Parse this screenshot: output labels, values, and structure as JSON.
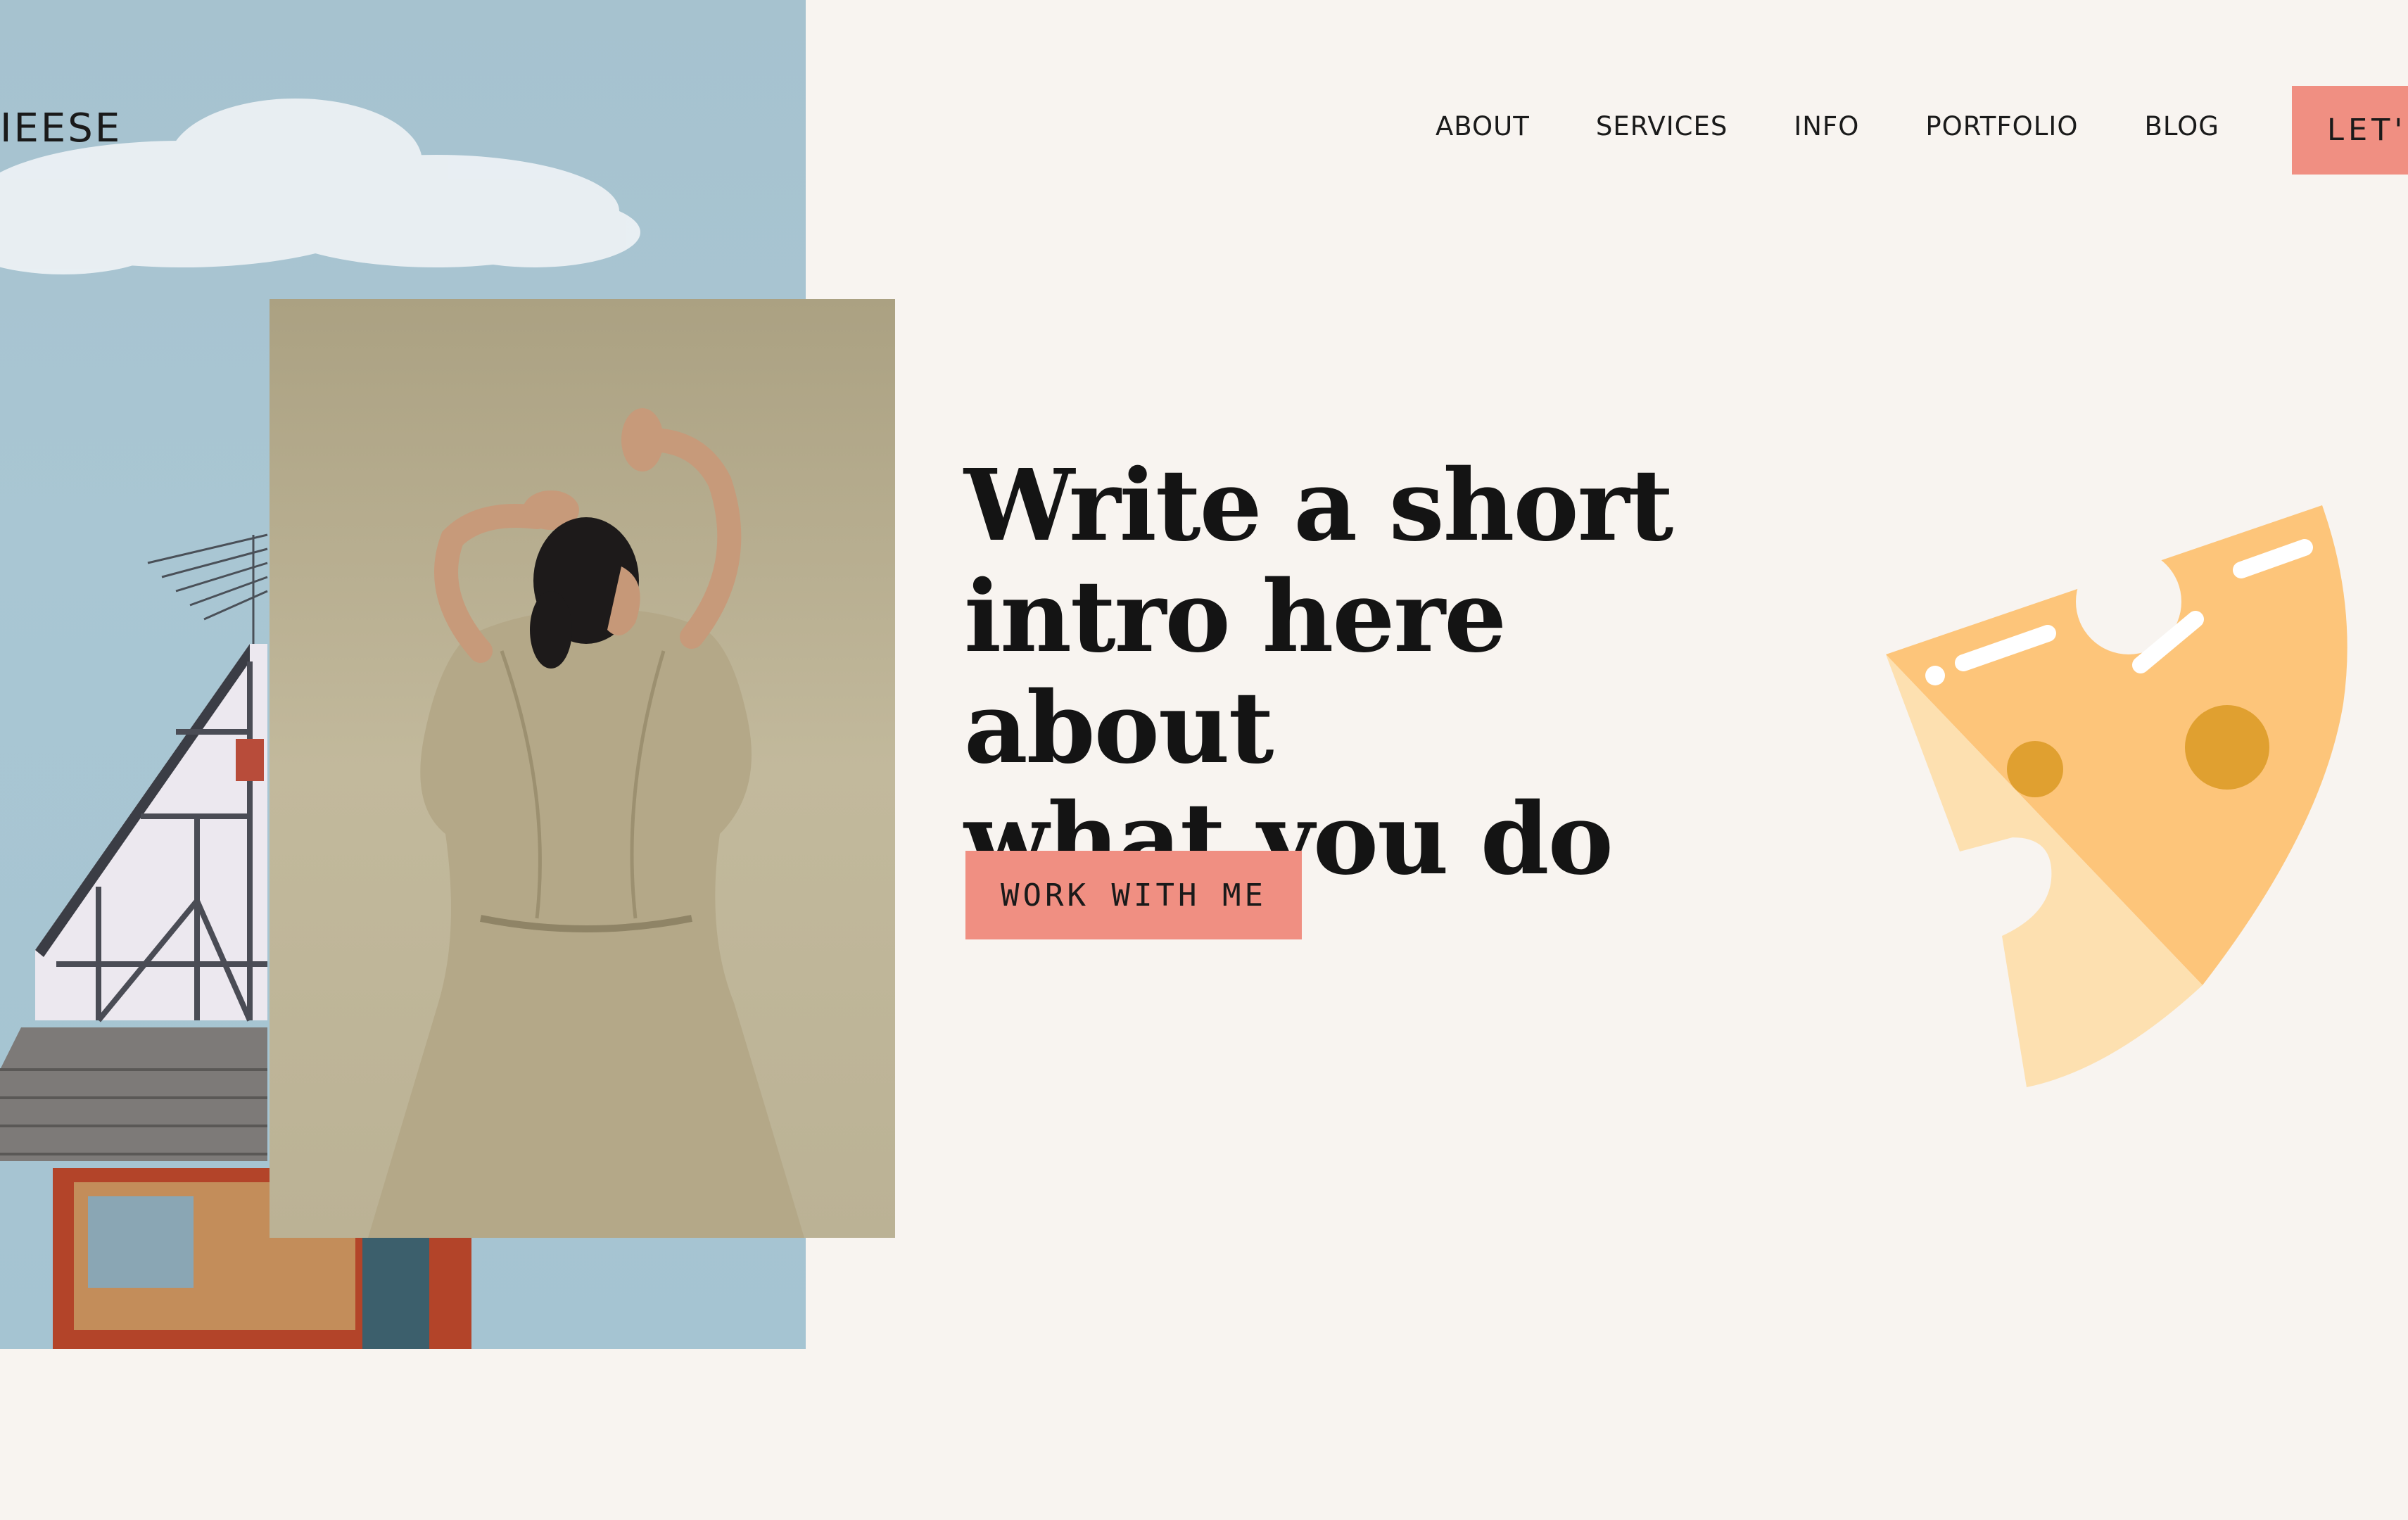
{
  "brand": {
    "name": "IEESE"
  },
  "nav": {
    "items": [
      {
        "label": "ABOUT"
      },
      {
        "label": "SERVICES"
      },
      {
        "label": "INFO"
      },
      {
        "label": "PORTFOLIO"
      },
      {
        "label": "BLOG"
      }
    ],
    "cta_label": "LET'"
  },
  "hero": {
    "headline_line1": "Write a short",
    "headline_line2": "intro here about",
    "headline_line3": "what you do",
    "button_label": "WORK WITH ME"
  },
  "colors": {
    "background": "#f8f4f0",
    "accent": "#f08f82",
    "sky": "#a6c2cf",
    "cheese_light": "#fdc57a",
    "cheese_pale": "#fde0b0",
    "cheese_hole": "#e0a030"
  },
  "icons": {
    "cheese": "cheese-slice-illustration"
  }
}
